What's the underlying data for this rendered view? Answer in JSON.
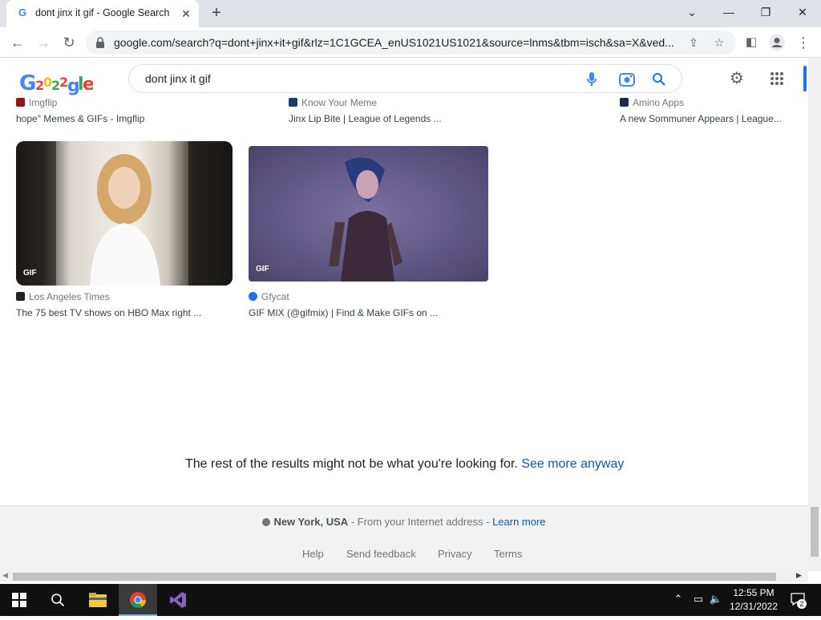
{
  "browser": {
    "tab_title": "dont jinx it gif - Google Search",
    "tab_favicon": "G",
    "new_tab": "+",
    "url": "google.com/search?q=dont+jinx+it+gif&rlz=1C1GCEA_enUS1021US1021&source=lnms&tbm=isch&sa=X&ved...",
    "window_controls": {
      "minimize": "—",
      "restore": "❐",
      "close": "✕",
      "tab_search": "⌄"
    }
  },
  "google": {
    "logo_text": "Google",
    "query": "dont jinx it gif"
  },
  "results_top_row": [
    {
      "source": "Imgflip",
      "caption": "hope\" Memes & GIFs - Imgflip",
      "icon_color": "#8b1a1a"
    },
    {
      "source": "Know Your Meme",
      "caption": "Jinx Lip Bite | League of Legends ...",
      "icon_color": "#1d3b6b"
    },
    {
      "source": "Amino Apps",
      "caption": "A new Sommuner Appears | League...",
      "icon_color": "#1d2a4a"
    }
  ],
  "results_bottom_row": [
    {
      "source": "Los Angeles Times",
      "caption": "The 75 best TV shows on HBO Max right ...",
      "badge": "GIF",
      "icon_color": "#222222"
    },
    {
      "source": "Gfycat",
      "caption": "GIF MIX (@gifmix) | Find & Make GIFs on ...",
      "badge": "GIF",
      "icon_color": "#1a73e8"
    }
  ],
  "rest_message": {
    "text": "The rest of the results might not be what you're looking for.",
    "link": "See more anyway"
  },
  "footer": {
    "location": "New York, USA",
    "location_suffix": " - From your Internet address - ",
    "learn_more": "Learn more",
    "links": [
      "Help",
      "Send feedback",
      "Privacy",
      "Terms"
    ]
  },
  "taskbar": {
    "time": "12:55 PM",
    "date": "12/31/2022",
    "notification_count": "2"
  }
}
